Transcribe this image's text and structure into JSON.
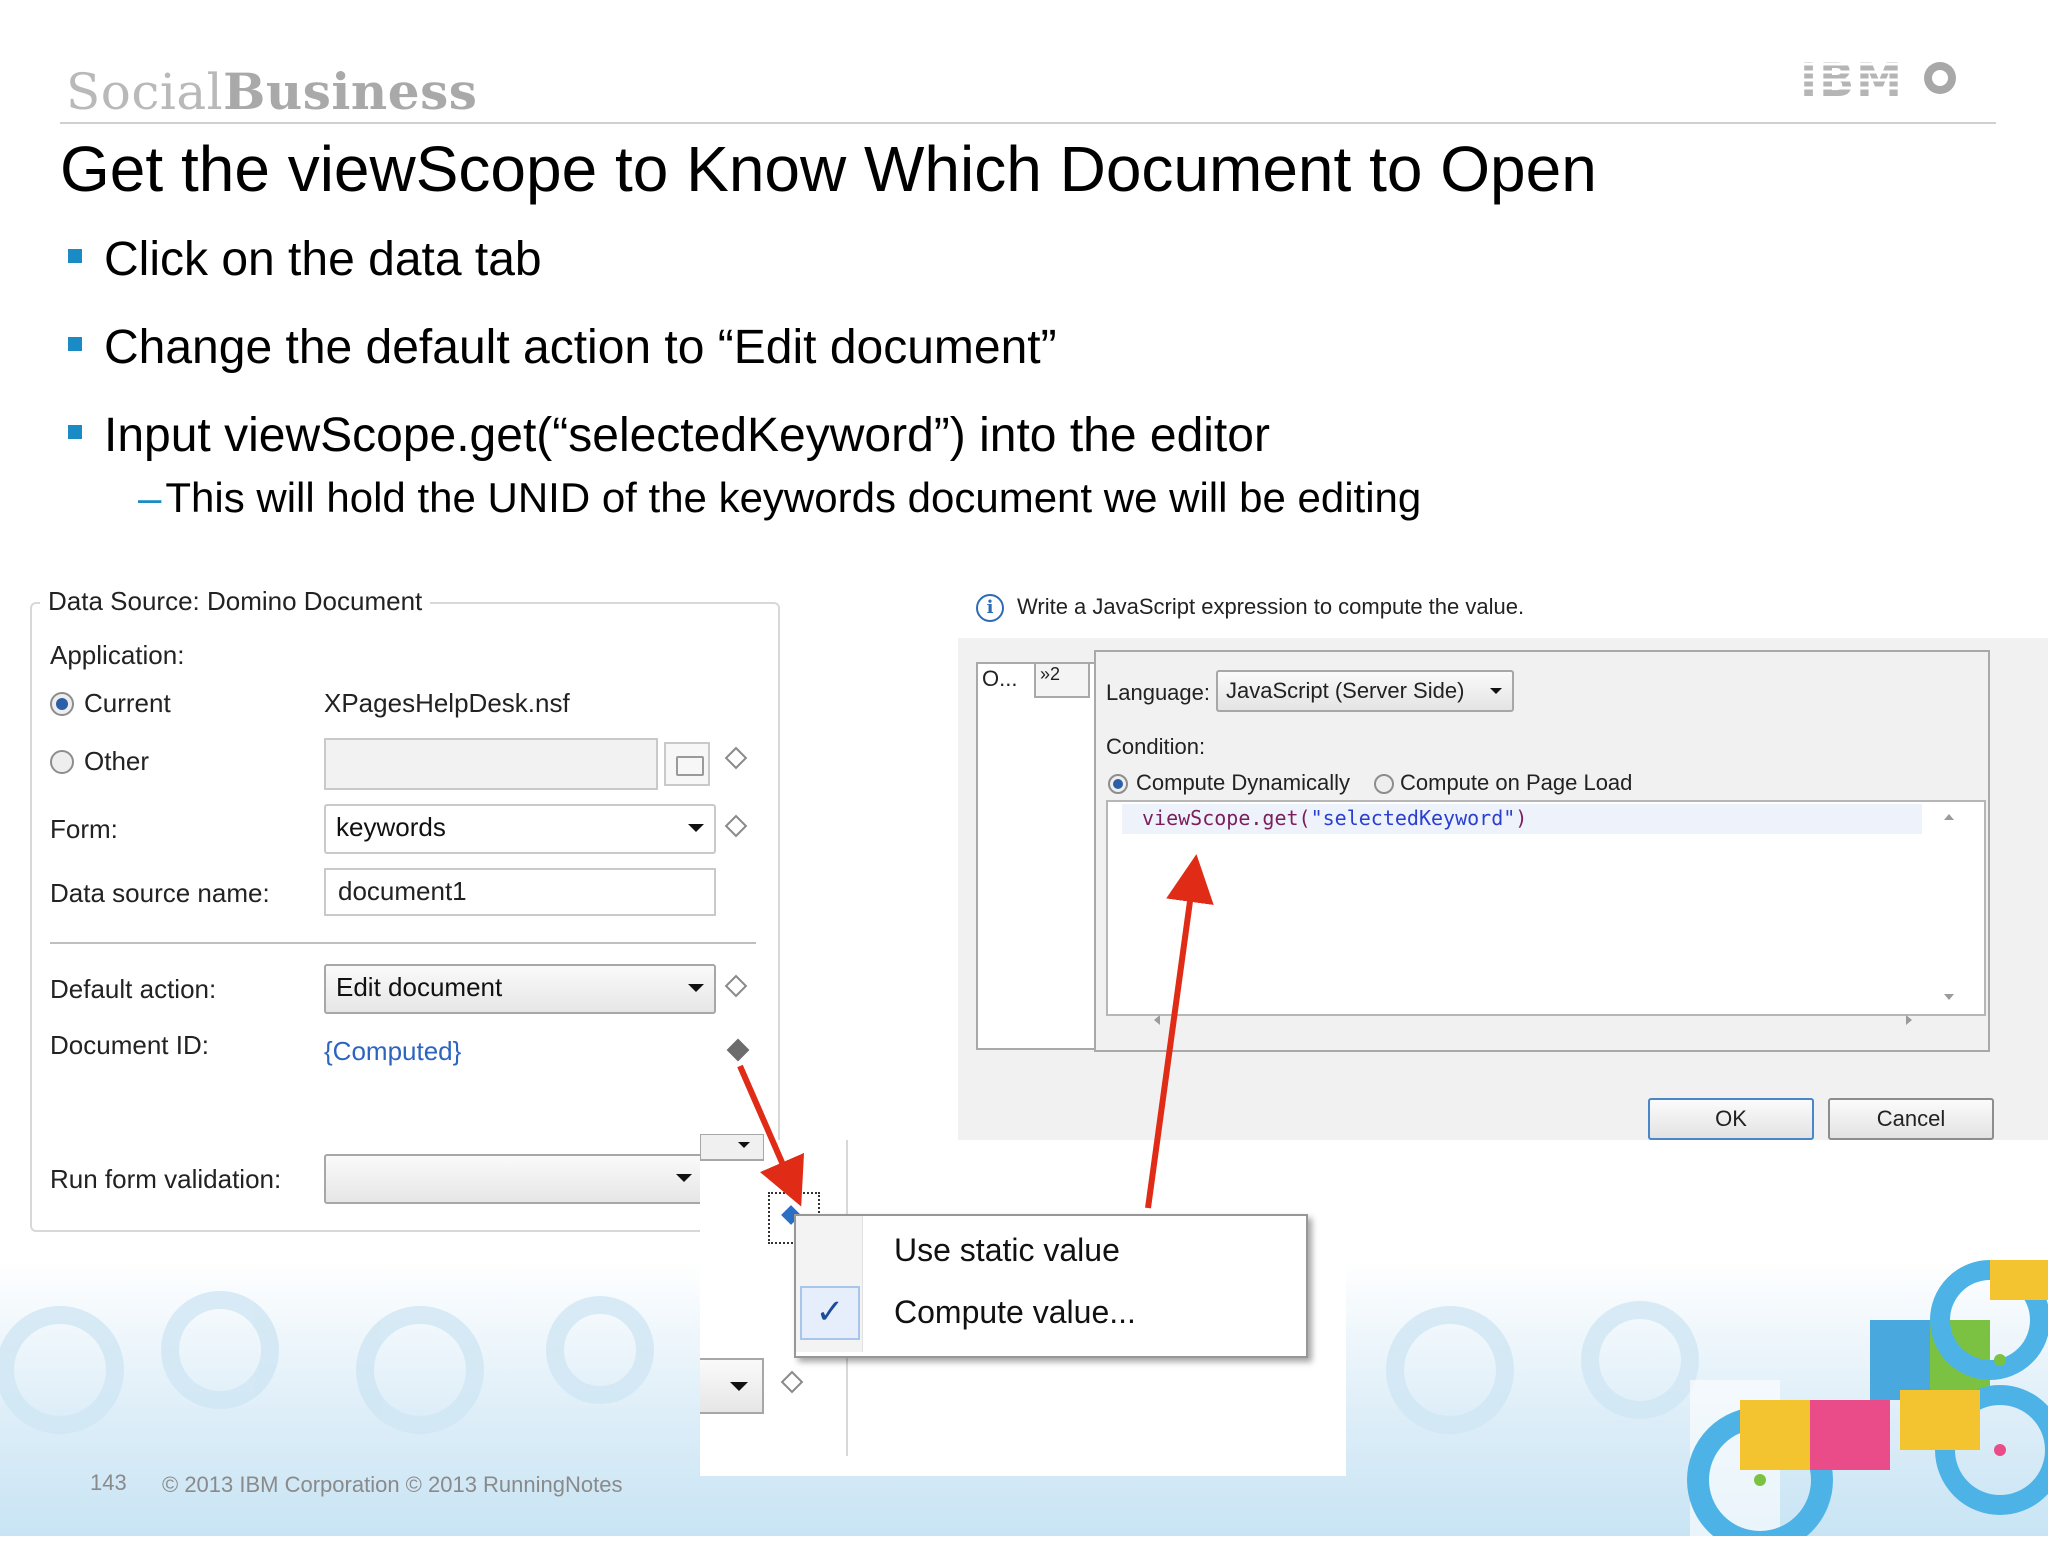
{
  "header": {
    "brand_light": "Social",
    "brand_bold": "Business",
    "logo_text": "IBM"
  },
  "slide": {
    "title": "Get the viewScope to Know Which Document to Open",
    "bullets": [
      "Click on the data tab",
      "Change the default action to “Edit document”",
      "Input viewScope.get(“selectedKeyword”) into the editor"
    ],
    "sub_bullet": "This will hold the UNID of the keywords document we will be editing"
  },
  "data_source_panel": {
    "legend": "Data Source: Domino Document",
    "application_label": "Application:",
    "current_label": "Current",
    "current_value": "XPagesHelpDesk.nsf",
    "other_label": "Other",
    "form_label": "Form:",
    "form_value": "keywords",
    "data_source_name_label": "Data source name:",
    "data_source_name_value": "document1",
    "default_action_label": "Default action:",
    "default_action_value": "Edit document",
    "document_id_label": "Document ID:",
    "document_id_value": "{Computed}",
    "run_form_validation_label": "Run form validation:"
  },
  "script_dialog": {
    "info_text": "Write a JavaScript expression to compute the value.",
    "tab_label": "O...",
    "tab_more": "»2",
    "language_label": "Language:",
    "language_value": "JavaScript (Server Side)",
    "condition_label": "Condition:",
    "compute_dynamically": "Compute Dynamically",
    "compute_on_page_load": "Compute on Page Load",
    "code_prefix": "viewScope.get(",
    "code_string": "\"selectedKeyword\"",
    "code_suffix": ")",
    "ok": "OK",
    "cancel": "Cancel"
  },
  "context_menu": {
    "item_1": "Use static value",
    "item_2": "Compute value...",
    "checkmark": "✓"
  },
  "footer": {
    "page_number": "143",
    "copyright": "© 2013 IBM Corporation  © 2013 RunningNotes"
  },
  "colors": {
    "bullet_accent": "#1a8bc4",
    "arrow_red": "#e02b17",
    "code_keyword": "#7a1f5c",
    "code_string": "#2a3fd0"
  }
}
